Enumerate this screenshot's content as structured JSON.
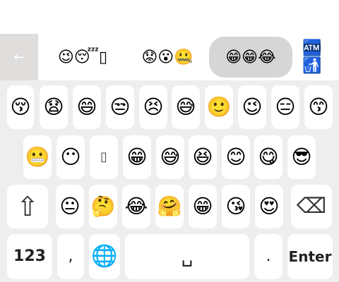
{
  "suggestions": {
    "back_icon": "←",
    "chips": [
      {
        "text": "😉😴▯",
        "selected": false
      },
      {
        "text": "😟😮🤐",
        "selected": false
      },
      {
        "text": "😁😁😂",
        "selected": true
      },
      {
        "text": "🏧🚮",
        "selected": false
      }
    ]
  },
  "keyboard": {
    "row1": [
      "😚",
      "😧",
      "😄",
      "😒",
      "😣",
      "😅",
      "🙂",
      "😉",
      "😑",
      "😙"
    ],
    "row2": [
      "😬",
      "😶",
      "▯",
      "😁",
      "😅",
      "😆",
      "😊",
      "😋",
      "😎"
    ],
    "row3": [
      "😐",
      "🤔",
      "😂",
      "🤗",
      "😁",
      "😘",
      "😍"
    ],
    "shift_icon": "⇧",
    "backspace_icon": "⌫",
    "bottom": {
      "mode_label": "123",
      "comma": ",",
      "globe_icon": "🌐",
      "space_glyph": "␣",
      "period": ".",
      "enter_label": "Enter"
    }
  }
}
